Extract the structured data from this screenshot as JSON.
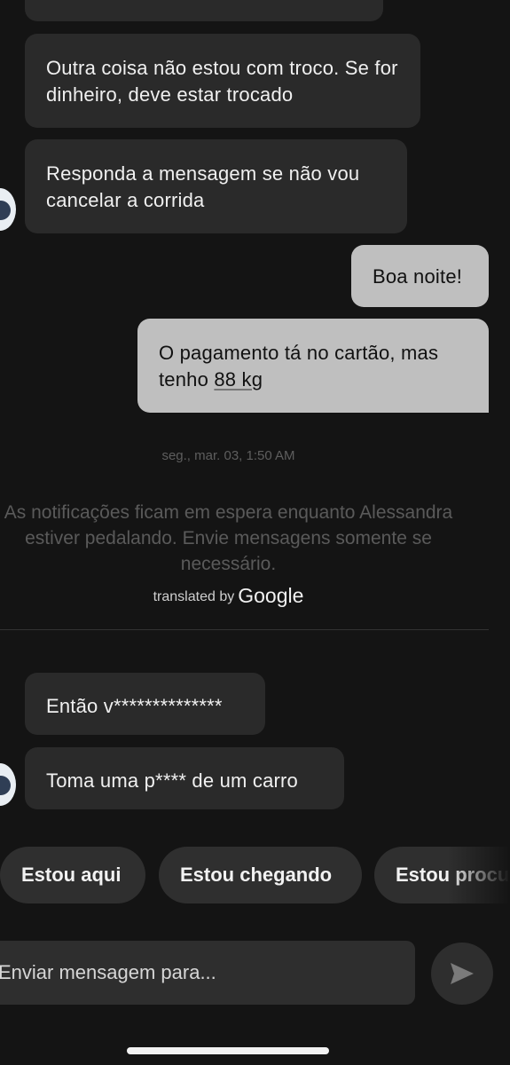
{
  "messages": [
    {
      "side": "in",
      "text": "Outra coisa não estou com troco. Se for dinheiro, deve estar trocado"
    },
    {
      "side": "in",
      "text": "Responda a mensagem se não vou cancelar a corrida"
    },
    {
      "side": "out",
      "text": "Boa noite!"
    },
    {
      "side": "out",
      "text_before": "O pagamento tá no cartão, mas tenho ",
      "text_underlined": "88 kg"
    },
    {
      "side": "in",
      "text": "Então v**************"
    },
    {
      "side": "in",
      "text": "Toma uma p**** de um carro"
    }
  ],
  "timestamp": "seg., mar. 03, 1:50 AM",
  "notice": "As notificações ficam em espera enquanto Alessandra estiver pedalando. Envie mensagens somente se necessário.",
  "translation": {
    "prefix": "translated by",
    "brand": "Google"
  },
  "quick_replies": [
    "Estou aqui",
    "Estou chegando",
    "Estou procurando"
  ],
  "composer": {
    "placeholder": "Enviar mensagem para..."
  },
  "icons": {
    "send": "send-arrow-icon",
    "avatar": "driver-avatar"
  },
  "colors": {
    "background": "#141414",
    "incoming_bubble": "#2a2a2a",
    "outgoing_bubble": "#bfbfbf"
  }
}
